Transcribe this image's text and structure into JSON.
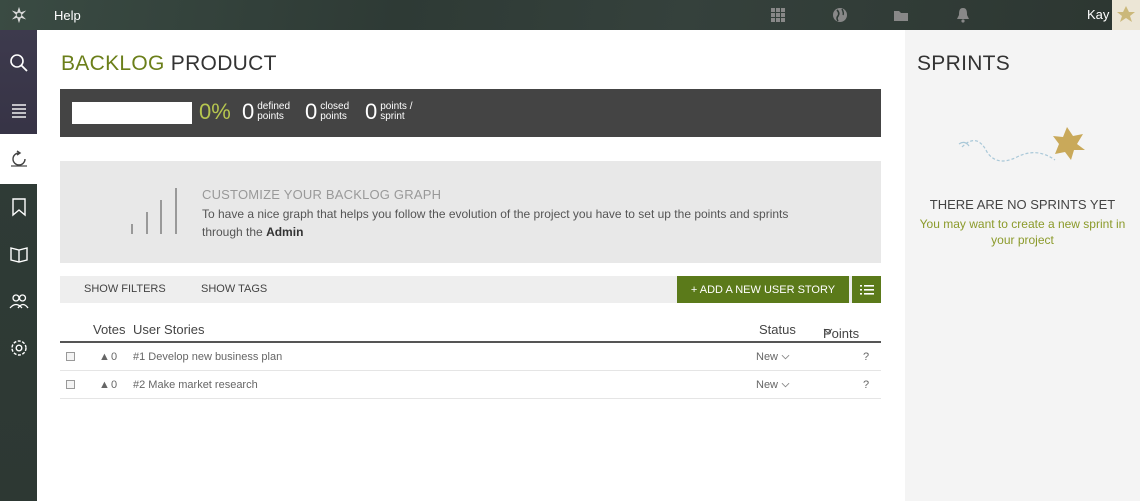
{
  "topbar": {
    "help_label": "Help",
    "user_name": "Kay",
    "icons": [
      "taiga-logo-icon",
      "grid-icon",
      "globe-icon",
      "folder-icon",
      "bell-icon"
    ]
  },
  "sidebar": {
    "items": [
      {
        "name": "search-icon"
      },
      {
        "name": "menu-icon"
      },
      {
        "name": "backlog-icon",
        "active": true
      },
      {
        "name": "bookmark-icon"
      },
      {
        "name": "wiki-book-icon"
      },
      {
        "name": "team-icon"
      },
      {
        "name": "settings-gear-icon"
      }
    ]
  },
  "page": {
    "title_accent": "BACKLOG",
    "title_rest": "PRODUCT"
  },
  "summary": {
    "percent": "0%",
    "defined_points_value": "0",
    "defined_points_label": "defined points",
    "closed_points_value": "0",
    "closed_points_label": "closed points",
    "points_sprint_value": "0",
    "points_sprint_label": "points / sprint",
    "progress_fraction": 0
  },
  "graph_box": {
    "title": "CUSTOMIZE YOUR BACKLOG GRAPH",
    "text": "To have a nice graph that helps you follow the evolution of the project you have to set up the points and sprints through the ",
    "link": "Admin"
  },
  "filters": {
    "show_filters": "SHOW FILTERS",
    "show_tags": "SHOW TAGS",
    "add_story": "+ ADD A NEW USER STORY"
  },
  "table": {
    "headers": {
      "votes": "Votes",
      "stories": "User Stories",
      "status": "Status",
      "points": "Points"
    },
    "rows": [
      {
        "votes": "0",
        "story": "#1 Develop new business plan",
        "status": "New",
        "points": "?"
      },
      {
        "votes": "0",
        "story": "#2 Make market research",
        "status": "New",
        "points": "?"
      }
    ]
  },
  "sprints": {
    "title": "SPRINTS",
    "empty_title": "THERE ARE NO SPRINTS YET",
    "empty_hint": "You may want to create a new sprint in your project"
  },
  "colors": {
    "accent_green": "#5b7a1a",
    "title_green": "#6b7f1a",
    "percent_green": "#b6c64f",
    "dark_panel": "#444444"
  }
}
